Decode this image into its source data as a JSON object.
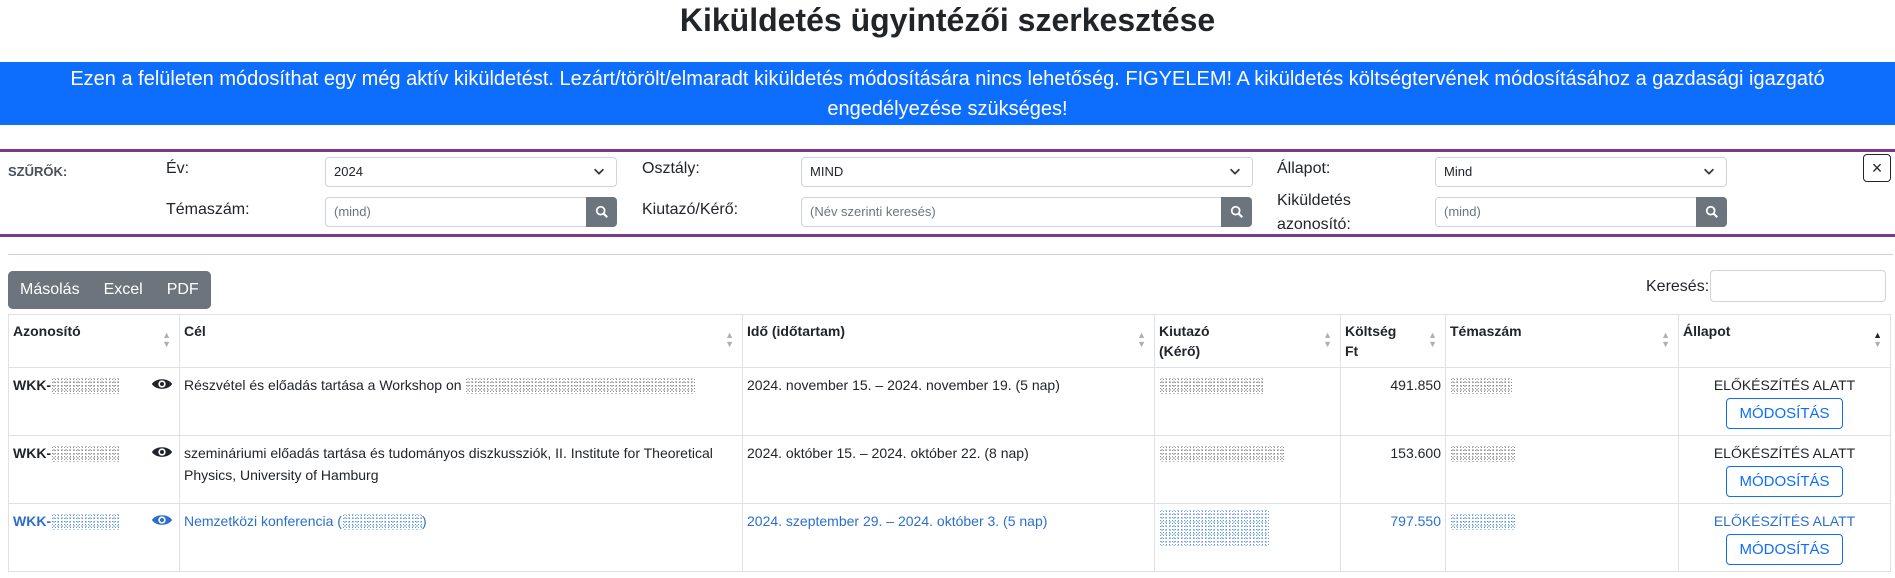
{
  "page": {
    "title": "Kiküldetés ügyintézői szerkesztése",
    "banner": "Ezen a felületen módosíthat egy még aktív kiküldetést. Lezárt/törölt/elmaradt kiküldetés módosítására nincs lehetőség. FIGYELEM! A kiküldetés költségtervének módosításához a gazdasági igazgató engedélyezése szükséges!"
  },
  "filters": {
    "heading": "SZŰRŐK:",
    "year_label": "Év:",
    "year_value": "2024",
    "department_label": "Osztály:",
    "department_value": "MIND",
    "status_label": "Állapot:",
    "status_value": "Mind",
    "topic_label": "Témaszám:",
    "topic_placeholder": "(mind)",
    "traveler_label": "Kiutazó/Kérő:",
    "traveler_placeholder": "(Név szerinti keresés)",
    "trip_id_label_line1": "Kiküldetés",
    "trip_id_label_line2": "azonosító:",
    "trip_id_placeholder": "(mind)",
    "close_symbol": "×"
  },
  "toolbar": {
    "copy_label": "Másolás",
    "excel_label": "Excel",
    "pdf_label": "PDF",
    "search_label": "Keresés:",
    "search_value": ""
  },
  "table": {
    "headers": {
      "id": "Azonosító",
      "goal": "Cél",
      "time": "Idő (időtartam)",
      "traveler_line1": "Kiutazó",
      "traveler_line2": "(Kérő)",
      "cost_line1": "Költség",
      "cost_line2": "Ft",
      "topic": "Témaszám",
      "status": "Állapot"
    },
    "rows": [
      {
        "id_prefix": "WKK-",
        "goal": "Részvétel és előadás tartása a Workshop on",
        "time": "2024. november 15. – 2024. november 19. (5 nap)",
        "cost": "491.850",
        "status": "ELŐKÉSZÍTÉS ALATT",
        "action": "MÓDOSÍTÁS"
      },
      {
        "id_prefix": "WKK-",
        "goal": "szemináriumi előadás tartása és tudományos diszkussziók, II. Institute for Theoretical Physics, University of Hamburg",
        "time": "2024. október 15. – 2024. október 22. (8 nap)",
        "cost": "153.600",
        "status": "ELŐKÉSZÍTÉS ALATT",
        "action": "MÓDOSÍTÁS"
      },
      {
        "id_prefix": "WKK-",
        "goal": "Nemzetközi konferencia (",
        "goal_suffix": ")",
        "time": "2024. szeptember 29. – 2024. október 3. (5 nap)",
        "cost": "797.550",
        "status": "ELŐKÉSZÍTÉS ALATT",
        "action": "MÓDOSÍTÁS"
      }
    ]
  },
  "colors": {
    "banner_bg": "#0d6efd",
    "filter_border": "#7b3b8c",
    "link_blue": "#2a6fd0",
    "button_gray": "#6c757d"
  }
}
